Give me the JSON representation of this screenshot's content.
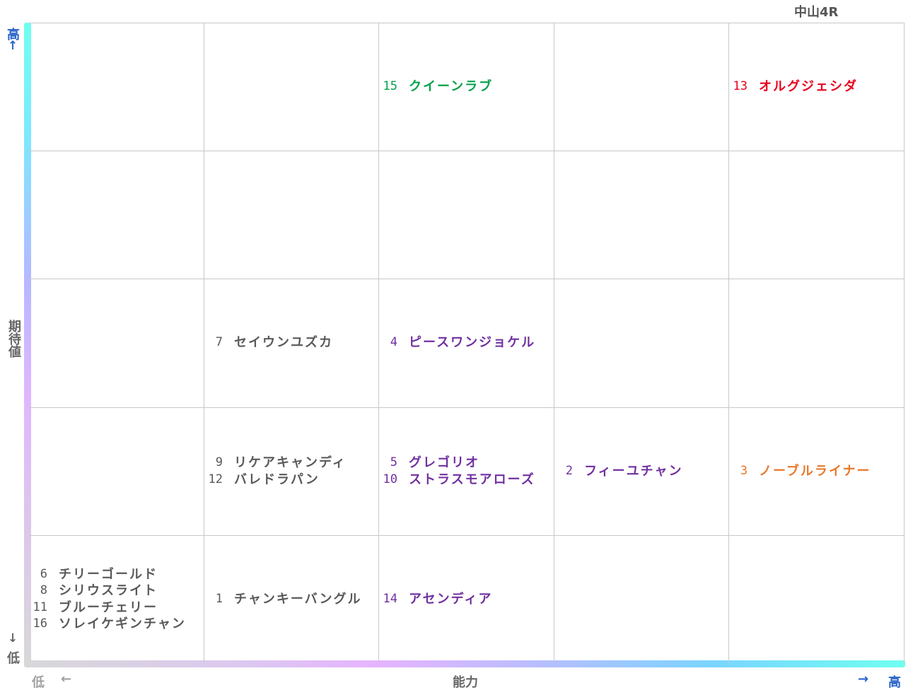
{
  "title": "中山4R",
  "axes": {
    "y_label": "期待値",
    "y_high": "高",
    "y_high_arrow": "↑",
    "y_low_arrow": "↓",
    "y_low": "低",
    "x_label": "能力",
    "x_low": "低",
    "x_low_arrow": "←",
    "x_high_arrow": "→",
    "x_high": "高"
  },
  "colors": {
    "gray": "#595959",
    "purple": "#7030a0",
    "green": "#00a14b",
    "red": "#e8001c",
    "orange": "#e8782a",
    "axis_blue": "#2a63c9",
    "axis_gray": "#666666",
    "grid": "#c8c8c8"
  },
  "chart_data": {
    "type": "table",
    "xlabel": "能力",
    "ylabel": "期待値",
    "columns": 5,
    "rows": 5,
    "cells": [
      {
        "col": 3,
        "row": 1,
        "color": "green",
        "entries": [
          {
            "num": "15",
            "name": "クイーンラブ"
          }
        ]
      },
      {
        "col": 5,
        "row": 1,
        "color": "red",
        "entries": [
          {
            "num": "13",
            "name": "オルグジェシダ"
          }
        ]
      },
      {
        "col": 2,
        "row": 3,
        "color": "gray",
        "entries": [
          {
            "num": "7",
            "name": "セイウンユズカ"
          }
        ]
      },
      {
        "col": 3,
        "row": 3,
        "color": "purple",
        "entries": [
          {
            "num": "4",
            "name": "ピースワンジョケル"
          }
        ]
      },
      {
        "col": 2,
        "row": 4,
        "color": "gray",
        "entries": [
          {
            "num": "9",
            "name": "リケアキャンディ"
          },
          {
            "num": "12",
            "name": "バレドラパン"
          }
        ]
      },
      {
        "col": 3,
        "row": 4,
        "color": "purple",
        "entries": [
          {
            "num": "5",
            "name": "グレゴリオ"
          },
          {
            "num": "10",
            "name": "ストラスモアローズ"
          }
        ]
      },
      {
        "col": 4,
        "row": 4,
        "color": "purple",
        "entries": [
          {
            "num": "2",
            "name": "フィーユチャン"
          }
        ]
      },
      {
        "col": 5,
        "row": 4,
        "color": "orange",
        "entries": [
          {
            "num": "3",
            "name": "ノーブルライナー"
          }
        ]
      },
      {
        "col": 1,
        "row": 5,
        "color": "gray",
        "entries": [
          {
            "num": "6",
            "name": "チリーゴールド"
          },
          {
            "num": "8",
            "name": "シリウスライト"
          },
          {
            "num": "11",
            "name": "ブルーチェリー"
          },
          {
            "num": "16",
            "name": "ソレイケギンチャン"
          }
        ]
      },
      {
        "col": 2,
        "row": 5,
        "color": "gray",
        "entries": [
          {
            "num": "1",
            "name": "チャンキーバングル"
          }
        ]
      },
      {
        "col": 3,
        "row": 5,
        "color": "purple",
        "entries": [
          {
            "num": "14",
            "name": "アセンディア"
          }
        ]
      }
    ]
  }
}
